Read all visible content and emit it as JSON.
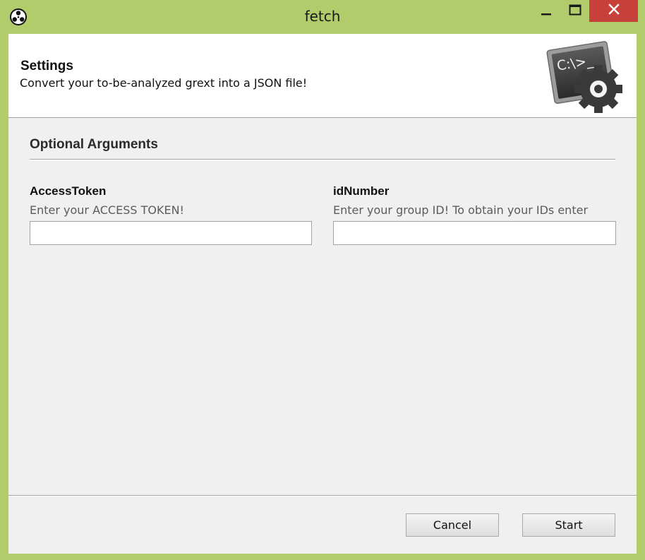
{
  "window": {
    "title": "fetch",
    "icons": {
      "app": "app-logo-icon",
      "minimize": "minimize-icon",
      "maximize": "maximize-icon",
      "close": "close-icon"
    },
    "close_color": "#c7413a",
    "frame_color": "#b3cc6b"
  },
  "header": {
    "title": "Settings",
    "description": "Convert your to-be-analyzed grext into a JSON file!",
    "logo_icon": "terminal-gear-icon",
    "logo_text": "C:\\>_"
  },
  "section": {
    "title": "Optional Arguments"
  },
  "fields": [
    {
      "label": "AccessToken",
      "hint": "Enter your ACCESS TOKEN!",
      "value": ""
    },
    {
      "label": "idNumber",
      "hint": "Enter your group ID! To obtain your IDs enter",
      "value": ""
    }
  ],
  "buttons": {
    "cancel": "Cancel",
    "start": "Start"
  }
}
